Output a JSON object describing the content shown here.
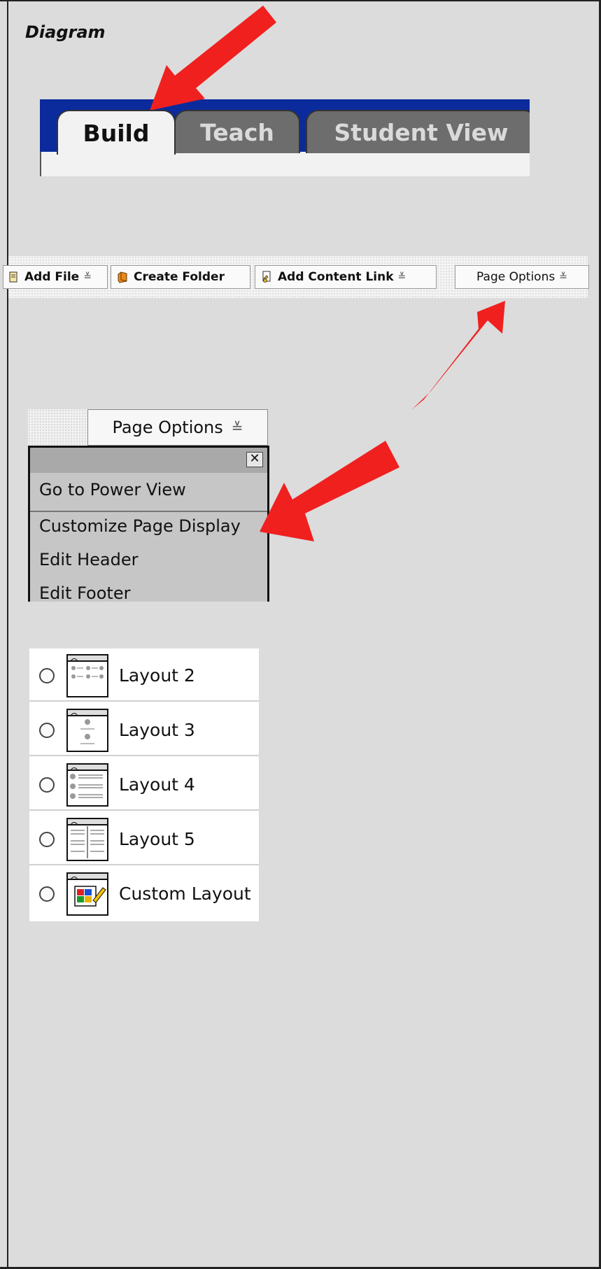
{
  "heading": "Diagram",
  "tabs": [
    {
      "label": "Build"
    },
    {
      "label": "Teach"
    },
    {
      "label": "Student View"
    }
  ],
  "toolbar": {
    "add_file": "Add File",
    "create_folder": "Create Folder",
    "add_content_link": "Add Content Link",
    "page_options": "Page Options",
    "dropdown_glyph": "≚"
  },
  "menu": {
    "button_label": "Page Options",
    "close_glyph": "✕",
    "items": [
      "Go to Power View",
      "Customize Page Display",
      "Edit Header",
      "Edit Footer"
    ]
  },
  "layouts": [
    {
      "label": "Layout 2",
      "icon": "layout-2-icon"
    },
    {
      "label": "Layout 3",
      "icon": "layout-3-icon"
    },
    {
      "label": "Layout 4",
      "icon": "layout-4-icon"
    },
    {
      "label": "Layout 5",
      "icon": "layout-5-icon"
    },
    {
      "label": "Custom Layout",
      "icon": "custom-layout-icon"
    }
  ],
  "colors": {
    "background": "#dcdcdc",
    "tab_bar": "#0b2a9c",
    "arrow": "#f0201f"
  }
}
